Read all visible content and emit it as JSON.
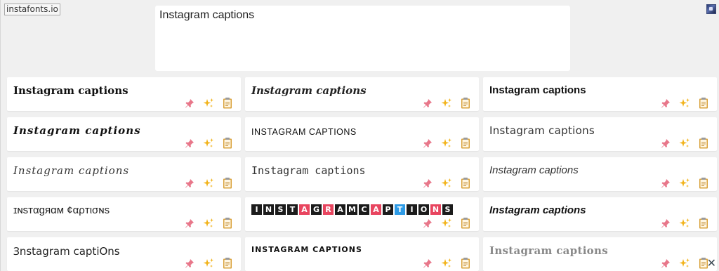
{
  "header": {
    "logo_text": "instafonts.io",
    "input_text": "Instagram captions"
  },
  "icons": {
    "pin": "pushpin-icon",
    "sparkle": "sparkles-icon",
    "copy": "clipboard-icon"
  },
  "colors": {
    "pin": "#e8778a",
    "sparkle": "#f2b31a",
    "copy": "#d9a13a",
    "badge_red": "#e8455f",
    "badge_blue": "#2e9be6"
  },
  "results": [
    {
      "text": "Instagram captions"
    },
    {
      "text": "Instagram captions"
    },
    {
      "text": "Instagram captions"
    },
    {
      "text": "Instagram captions"
    },
    {
      "text": "INSTAGRAM CAPTIONS"
    },
    {
      "text": "Instagram captions"
    },
    {
      "text": "Instagram captions"
    },
    {
      "text": "Instagram captions"
    },
    {
      "text": "Instagram captions"
    },
    {
      "text": "ɪɴѕтαgяαм ¢αρтισɴѕ"
    },
    {
      "text": "INSTAGRAMCAPTIONS"
    },
    {
      "text": "Instagram captions"
    },
    {
      "text": "Ɜnstagram captiOns"
    },
    {
      "text": "INSTAGRAM CAPTIONS"
    },
    {
      "text": "Instagram captions"
    }
  ]
}
